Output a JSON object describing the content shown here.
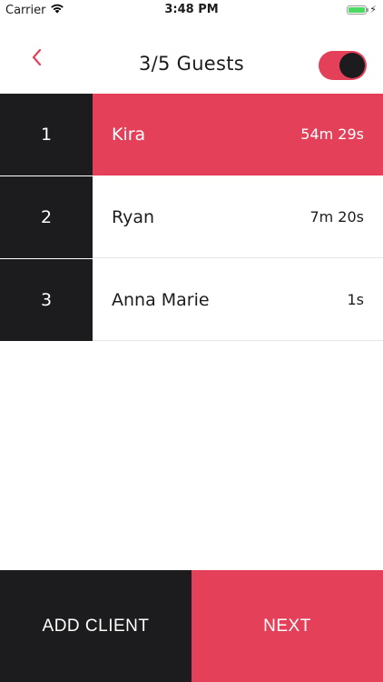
{
  "status_bar": {
    "carrier": "Carrier",
    "time": "3:48 PM",
    "battery_percent": 100
  },
  "header": {
    "title": "3/5 Guests",
    "toggle_on": true,
    "accent_color": "#e5405a"
  },
  "guests": [
    {
      "number": "1",
      "name": "Kira",
      "elapsed": "54m 29s",
      "active": true
    },
    {
      "number": "2",
      "name": "Ryan",
      "elapsed": "7m 20s",
      "active": false
    },
    {
      "number": "3",
      "name": "Anna Marie",
      "elapsed": "1s",
      "active": false
    }
  ],
  "footer": {
    "add_label": "ADD CLIENT",
    "next_label": "NEXT"
  },
  "colors": {
    "accent": "#e5405a",
    "dark": "#1c1b1d"
  }
}
